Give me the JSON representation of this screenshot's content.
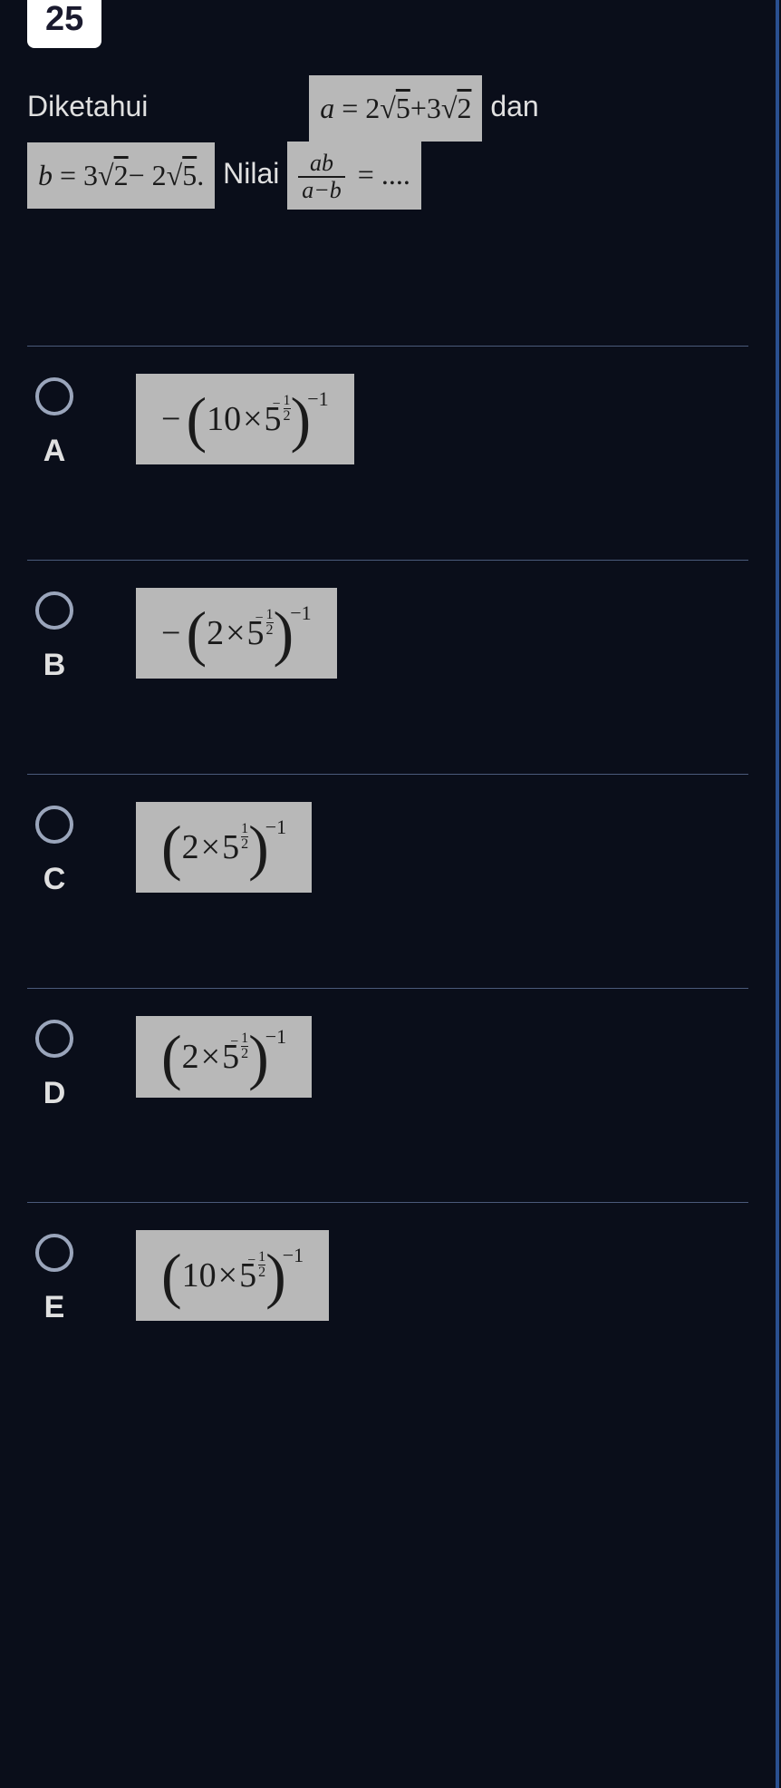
{
  "question": {
    "number": "25",
    "text_before_a": "Diketahui",
    "math_a": "a = 2√5+3√2",
    "text_dan": "dan",
    "math_b": "b = 3√2− 2√5.",
    "text_nilai": "Nilai",
    "frac_num": "ab",
    "frac_den": "a−b",
    "eq_dots": "= ...."
  },
  "answers": {
    "A": {
      "label": "A",
      "sign": "−",
      "base": "10",
      "mult": "×",
      "base2": "5",
      "inner_exp_neg": true,
      "inner_exp_num": "1",
      "inner_exp_den": "2",
      "outer_exp": "−1"
    },
    "B": {
      "label": "B",
      "sign": "−",
      "base": "2",
      "mult": "×",
      "base2": "5",
      "inner_exp_neg": true,
      "inner_exp_num": "1",
      "inner_exp_den": "2",
      "outer_exp": "−1"
    },
    "C": {
      "label": "C",
      "sign": "",
      "base": "2",
      "mult": "×",
      "base2": "5",
      "inner_exp_neg": false,
      "inner_exp_num": "1",
      "inner_exp_den": "2",
      "outer_exp": "−1"
    },
    "D": {
      "label": "D",
      "sign": "",
      "base": "2",
      "mult": "×",
      "base2": "5",
      "inner_exp_neg": true,
      "inner_exp_num": "1",
      "inner_exp_den": "2",
      "outer_exp": "−1"
    },
    "E": {
      "label": "E",
      "sign": "",
      "base": "10",
      "mult": "×",
      "base2": "5",
      "inner_exp_neg": true,
      "inner_exp_num": "1",
      "inner_exp_den": "2",
      "outer_exp": "−1"
    }
  }
}
